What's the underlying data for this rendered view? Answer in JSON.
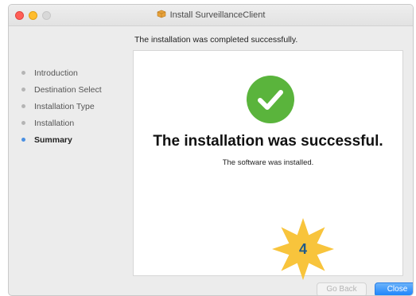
{
  "window": {
    "title": "Install SurveillanceClient"
  },
  "header": {
    "message": "The installation was completed successfully."
  },
  "sidebar": {
    "steps": [
      {
        "label": "Introduction"
      },
      {
        "label": "Destination Select"
      },
      {
        "label": "Installation Type"
      },
      {
        "label": "Installation"
      },
      {
        "label": "Summary"
      }
    ],
    "active_step": "Summary"
  },
  "main": {
    "status_icon": "checkmark-icon",
    "title": "The installation was successful.",
    "subtitle": "The software was installed."
  },
  "annotation": {
    "badge_number": "4",
    "badge_color": "#f8c43c"
  },
  "buttons": {
    "back_label": "Go Back",
    "close_label": "Close"
  },
  "colors": {
    "success_green": "#5ab43c",
    "accent_blue": "#1a82fb"
  }
}
